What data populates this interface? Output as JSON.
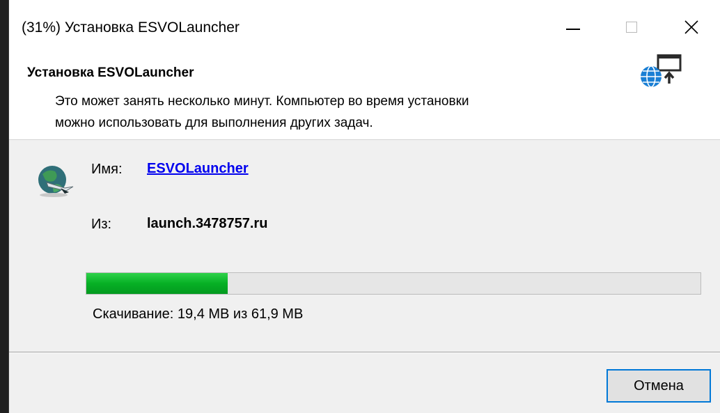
{
  "window": {
    "title": "(31%) Установка ESVOLauncher"
  },
  "icons": {
    "minimize": "minimize-icon",
    "maximize": "maximize-icon",
    "close": "close-icon",
    "install": "globe-install-icon",
    "app": "app-globe-icon"
  },
  "header": {
    "title": "Установка ESVOLauncher",
    "description_line1": "Это может занять несколько минут. Компьютер во время установки",
    "description_line2": "можно использовать для выполнения других задач."
  },
  "details": {
    "name_label": "Имя:",
    "name_value": "ESVOLauncher",
    "from_label": "Из:",
    "from_value": "launch.3478757.ru"
  },
  "progress": {
    "percent": 23,
    "status": "Скачивание: 19,4 MB из 61,9 MB"
  },
  "buttons": {
    "cancel": "Отмена"
  },
  "colors": {
    "progress_green": "#06b025",
    "link_blue": "#0000ee",
    "focus_blue": "#0078d7"
  }
}
